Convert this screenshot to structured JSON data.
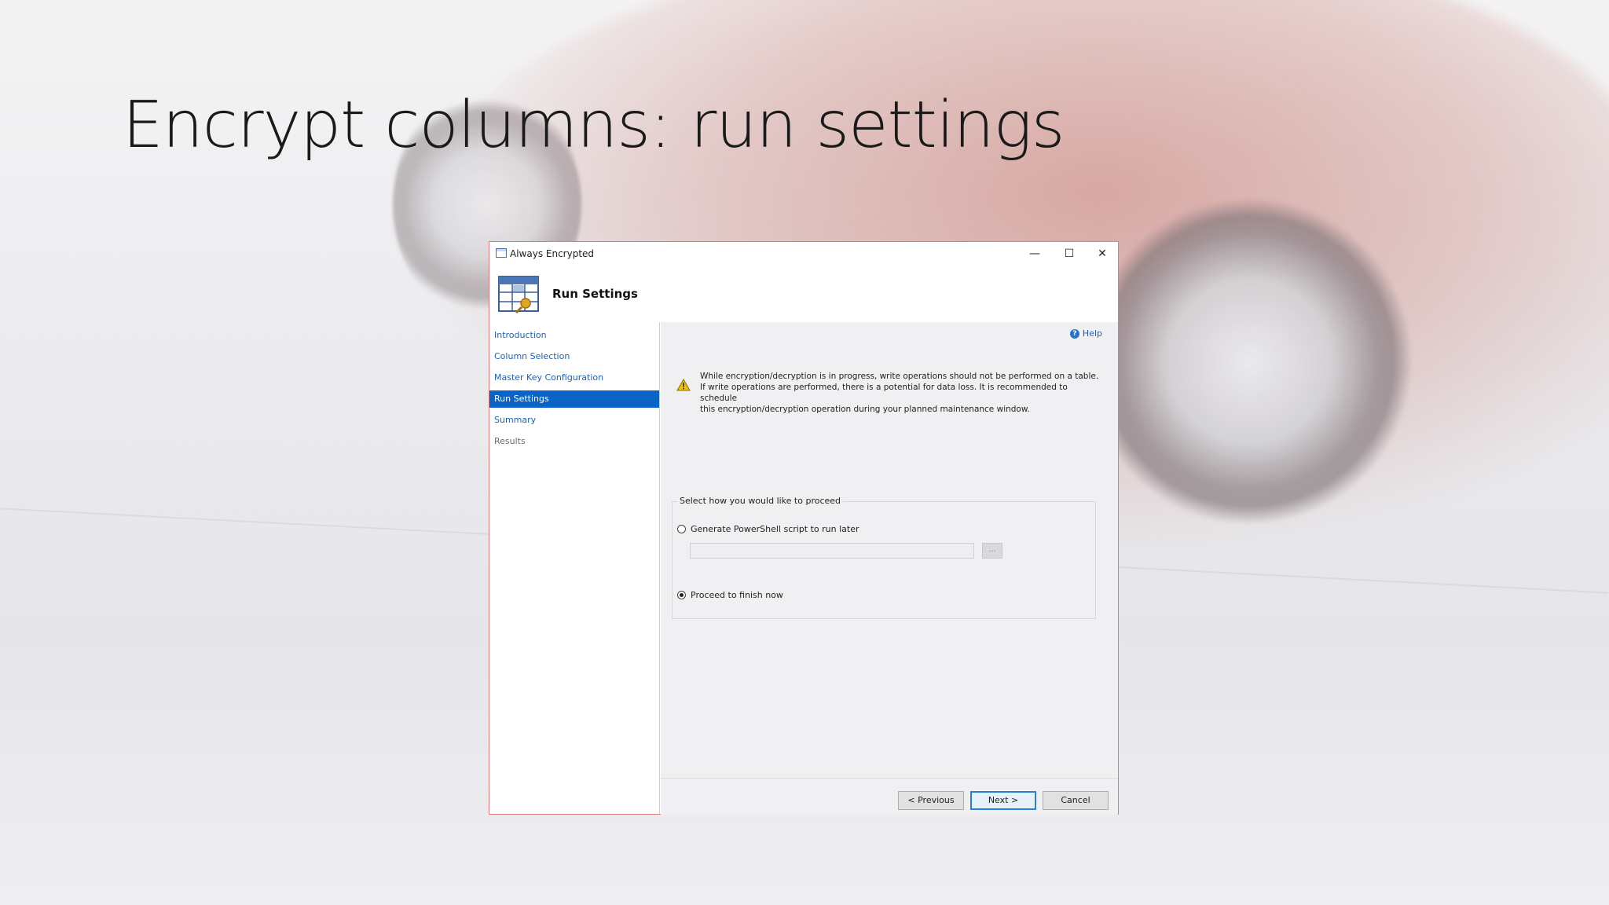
{
  "slide": {
    "title": "Encrypt columns: run settings"
  },
  "window": {
    "title": "Always Encrypted",
    "minimize": "—",
    "maximize": "☐",
    "close": "✕"
  },
  "header": {
    "title": "Run Settings",
    "icon": "table-key-icon"
  },
  "nav": {
    "items": [
      {
        "label": "Introduction",
        "state": "link"
      },
      {
        "label": "Column Selection",
        "state": "link"
      },
      {
        "label": "Master Key Configuration",
        "state": "link"
      },
      {
        "label": "Run Settings",
        "state": "active"
      },
      {
        "label": "Summary",
        "state": "link"
      },
      {
        "label": "Results",
        "state": "disabled"
      }
    ]
  },
  "help": {
    "label": "Help",
    "icon_glyph": "?"
  },
  "warning": {
    "line1": "While encryption/decryption is in progress, write operations should not be performed on a table.",
    "line2": "If write operations are performed, there is a potential for data loss. It is recommended to schedule",
    "line3": "this encryption/decryption operation during your planned maintenance window."
  },
  "proceed": {
    "group_label": "Select how you would like to proceed",
    "option_script": "Generate PowerShell script to run later",
    "script_path_value": "",
    "browse_label": "...",
    "option_now": "Proceed to finish now",
    "selected": "now"
  },
  "buttons": {
    "previous": "< Previous",
    "next": "Next >",
    "cancel": "Cancel"
  },
  "colors": {
    "accent": "#0a64c8",
    "link": "#1f5fb7",
    "dialog_border": "#e07b7b"
  }
}
